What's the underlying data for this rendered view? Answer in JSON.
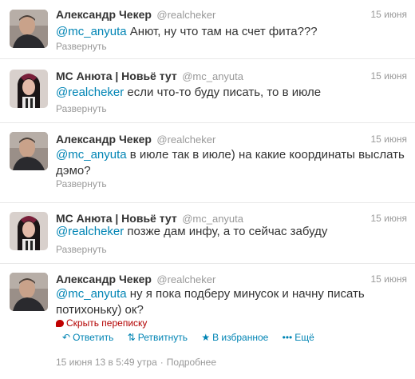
{
  "tweets": [
    {
      "name": "Александр Чекер",
      "handle": "@realcheker",
      "time": "15 июня",
      "mention": "@mc_anyuta",
      "text": " Анют, ну что там на счет фита???",
      "expand": "Развернуть"
    },
    {
      "name": "MC Анюта | Новьё тут",
      "handle": "@mc_anyuta",
      "time": "15 июня",
      "mention": "@realcheker",
      "text": " если что-то буду писать, то в июле",
      "expand": "Развернуть"
    },
    {
      "name": "Александр Чекер",
      "handle": "@realcheker",
      "time": "15 июня",
      "mention": "@mc_anyuta",
      "text": " в июле так в июле) на какие координаты выслать дэмо?",
      "expand": "Развернуть"
    },
    {
      "name": "MC Анюта | Новьё тут",
      "handle": "@mc_anyuta",
      "time": "15 июня",
      "mention": "@realcheker",
      "text": " позже дам инфу, а то сейчас забуду",
      "expand": "Развернуть"
    },
    {
      "name": "Александр Чекер",
      "handle": "@realcheker",
      "time": "15 июня",
      "mention": "@mc_anyuta",
      "text": " ну я пока подберу минусок и начну писать потихоньку) ок?",
      "collapse": "Скрыть переписку",
      "actions": {
        "reply": "Ответить",
        "retweet": "Ретвитнуть",
        "favorite": "В избранное",
        "more": "Ещё"
      },
      "timestamp": "15 июня 13 в 5:49 утра",
      "details": "Подробнее"
    }
  ],
  "colors": {
    "link": "#0084b4",
    "muted": "#999999",
    "text": "#333333",
    "collapse": "#b30000"
  },
  "icons": [
    "reply-icon",
    "retweet-icon",
    "favorite-icon",
    "more-icon",
    "conversation-icon"
  ]
}
